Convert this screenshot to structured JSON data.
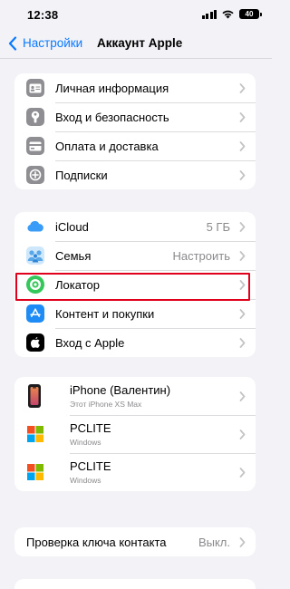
{
  "status": {
    "time": "12:38",
    "battery": "40",
    "icons": [
      "signal-icon",
      "wifi-icon",
      "battery-icon"
    ]
  },
  "nav": {
    "back_label": "Настройки",
    "title": "Аккаунт Apple"
  },
  "group1": {
    "items": [
      {
        "label": "Личная информация",
        "icon": "id-card-icon"
      },
      {
        "label": "Вход и безопасность",
        "icon": "lock-icon"
      },
      {
        "label": "Оплата и доставка",
        "icon": "credit-card-icon"
      },
      {
        "label": "Подписки",
        "icon": "subscriptions-icon"
      }
    ]
  },
  "group2": {
    "items": [
      {
        "label": "iCloud",
        "value": "5 ГБ",
        "icon": "icloud-icon"
      },
      {
        "label": "Семья",
        "value": "Настроить",
        "icon": "family-icon"
      },
      {
        "label": "Локатор",
        "icon": "find-my-icon"
      },
      {
        "label": "Контент и покупки",
        "icon": "app-store-icon"
      },
      {
        "label": "Вход с Apple",
        "icon": "apple-logo-icon"
      }
    ]
  },
  "group3": {
    "devices": [
      {
        "name": "iPhone (Валентин)",
        "detail": "Этот iPhone XS Max",
        "icon": "iphone-icon"
      },
      {
        "name": "PCLITE",
        "detail": "Windows",
        "icon": "windows-icon"
      },
      {
        "name": "PCLITE",
        "detail": "Windows",
        "icon": "windows-icon"
      }
    ]
  },
  "group4": {
    "label": "Проверка ключа контакта",
    "value": "Выкл."
  },
  "colors": {
    "accent": "#0a7aff",
    "background": "#f2f2f7",
    "highlight": "#e0001b"
  }
}
